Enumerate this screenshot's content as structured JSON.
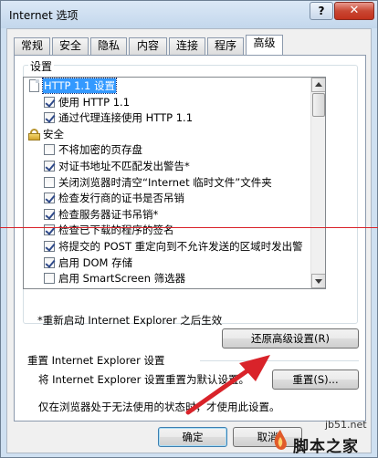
{
  "window": {
    "title": "Internet 选项",
    "help_glyph": "?",
    "close_glyph": "✕"
  },
  "tabs": [
    "常规",
    "安全",
    "隐私",
    "内容",
    "连接",
    "程序",
    "高级"
  ],
  "active_tab": "高级",
  "settings": {
    "group_label": "设置",
    "items": [
      {
        "type": "doc",
        "label": "HTTP 1.1 设置",
        "selected": true
      },
      {
        "type": "checkbox",
        "checked": true,
        "label": "使用 HTTP 1.1"
      },
      {
        "type": "checkbox",
        "checked": true,
        "label": "通过代理连接使用 HTTP 1.1"
      },
      {
        "type": "lock",
        "label": "安全"
      },
      {
        "type": "checkbox",
        "checked": false,
        "label": "不将加密的页存盘"
      },
      {
        "type": "checkbox",
        "checked": true,
        "label": "对证书地址不匹配发出警告*"
      },
      {
        "type": "checkbox",
        "checked": false,
        "label": "关闭浏览器时清空“Internet 临时文件”文件夹"
      },
      {
        "type": "checkbox",
        "checked": true,
        "label": "检查发行商的证书是否吊销"
      },
      {
        "type": "checkbox",
        "checked": true,
        "label": "检查服务器证书吊销*"
      },
      {
        "type": "checkbox",
        "checked": true,
        "label": "检查已下载的程序的签名"
      },
      {
        "type": "checkbox",
        "checked": true,
        "label": "将提交的 POST 重定向到不允许发送的区域时发出警"
      },
      {
        "type": "checkbox",
        "checked": true,
        "label": "启用 DOM 存储"
      },
      {
        "type": "checkbox",
        "checked": false,
        "label": "启用 SmartScreen 筛选器"
      }
    ]
  },
  "note": "*重新启动 Internet Explorer 之后生效",
  "restore_button": "还原高级设置(R)",
  "reset": {
    "group_label": "重置 Internet Explorer 设置",
    "description": "将 Internet Explorer 设置重置为默认设置。",
    "button": "重置(S)...",
    "warning": "仅在浏览器处于无法使用的状态时，才使用此设置。"
  },
  "footer": {
    "ok_button": "确定",
    "cancel_button": "取消"
  },
  "watermark": {
    "site": "jb51.net",
    "name": "脚本之家"
  },
  "colors": {
    "annotation_red": "#d9232a",
    "selection_blue": "#3399ff"
  }
}
